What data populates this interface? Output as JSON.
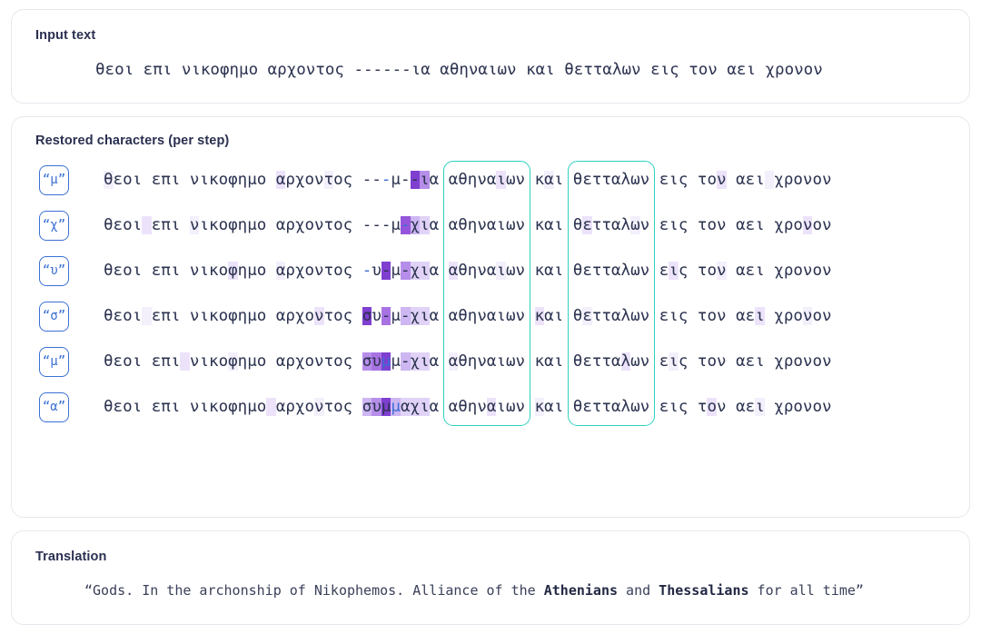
{
  "sections": {
    "input": {
      "title": "Input text",
      "text": "θεοι επι νικοφημο αρχοντος ------ια αθηναιων και θετταλων εις τον αει χρονον"
    },
    "restored": {
      "title": "Restored characters (per step)",
      "steps": [
        {
          "badge": "“μ”",
          "predicted": "μ",
          "text": "θεοι επι νικοφημο αρχοντος ---μ--ια αθηναιων και θετταλων εις τον αει χρονον"
        },
        {
          "badge": "“χ”",
          "predicted": "χ",
          "text": "θεοι επι νικοφημο αρχοντος ---μ-χια αθηναιων και θετταλων εις τον αει χρονον"
        },
        {
          "badge": "“υ”",
          "predicted": "υ",
          "text": "θεοι επι νικοφημο αρχοντος -υ-μ-χια αθηναιων και θετταλων εις τον αει χρονον"
        },
        {
          "badge": "“σ”",
          "predicted": "σ",
          "text": "θεοι επι νικοφημο αρχοντος συ-μ-χια αθηναιων και θετταλων εις τον αει χρονον"
        },
        {
          "badge": "“μ”",
          "predicted": "μ",
          "text": "θεοι επι νικοφημο αρχοντος συμμ-χια αθηναιων και θετταλων εις τον αει χρονον"
        },
        {
          "badge": "“α”",
          "predicted": "α",
          "text": "θεοι επι νικοφημο αρχοντος συμμαχια αθηναιων και θετταλων εις τον αει χρονον"
        }
      ],
      "highlight_boxes": [
        {
          "label": "αθηναιων"
        },
        {
          "label": "θετταλων"
        }
      ]
    },
    "translation": {
      "title": "Translation",
      "text": "“Gods. In the archonship of Nikophemos. Alliance of the Athenians and Thessalians for all time”",
      "parts": [
        {
          "text": "“Gods. In the archonship of Nikophemos. Alliance of the ",
          "bold": false
        },
        {
          "text": "Athenians",
          "bold": true
        },
        {
          "text": " and ",
          "bold": false
        },
        {
          "text": "Thessalians",
          "bold": true
        },
        {
          "text": " for all time”",
          "bold": false
        }
      ]
    }
  },
  "colors": {
    "accent_blue": "#3b6fd4",
    "teal_box": "#2fd0c0",
    "highlight_purple_strong": "#7f3fd0",
    "highlight_purple_mid": "#a872e3",
    "highlight_purple_light": "#ece3fa",
    "text_dark": "#2c3350",
    "card_border": "#e6e8ee"
  },
  "render": {
    "gap_start_index": 26,
    "gap_length": 8,
    "step_cell_highlights": [
      [
        0,
        0,
        0,
        0,
        0,
        0,
        8,
        5
      ],
      [
        0,
        0,
        0,
        0,
        0,
        7,
        4,
        3
      ],
      [
        0,
        0,
        0,
        8,
        0,
        5,
        3,
        3
      ],
      [
        0,
        8,
        0,
        6,
        0,
        4,
        3,
        3
      ],
      [
        0,
        5,
        6,
        8,
        0,
        4,
        3,
        3
      ],
      [
        0,
        4,
        5,
        8,
        4,
        3,
        3,
        3
      ]
    ],
    "step_new_char_index": [
      3,
      5,
      1,
      0,
      3,
      4
    ],
    "tail_tints": [
      [
        2,
        1,
        0,
        0,
        1,
        1,
        0,
        0
      ],
      [
        1,
        1,
        0,
        0,
        1,
        1,
        0,
        0
      ],
      [
        2,
        1,
        0,
        0,
        1,
        1,
        0,
        0
      ],
      [
        1,
        1,
        0,
        0,
        1,
        0,
        0,
        0
      ],
      [
        1,
        1,
        0,
        0,
        1,
        1,
        0,
        0
      ],
      [
        1,
        1,
        0,
        0,
        1,
        0,
        0,
        0
      ]
    ]
  }
}
